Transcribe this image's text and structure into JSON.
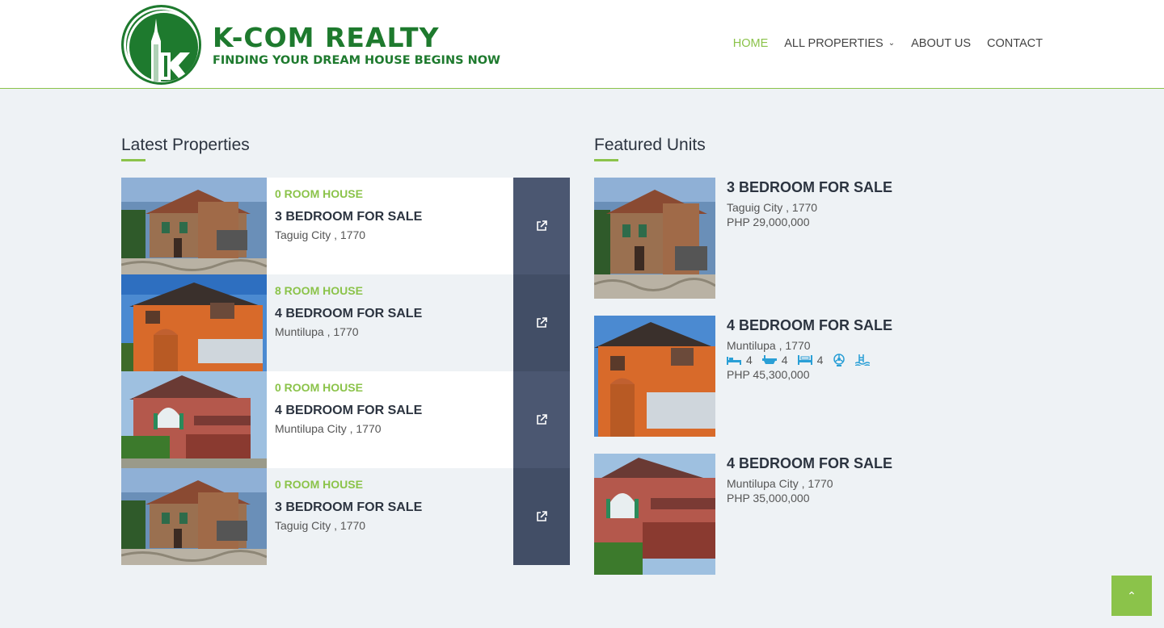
{
  "brand": {
    "logo_letter": "k",
    "title": "K-COM REALTY",
    "tagline": "FINDING YOUR DREAM HOUSE BEGINS NOW",
    "color": "#1e7a2e"
  },
  "nav": {
    "items": [
      {
        "label": "HOME",
        "active": true
      },
      {
        "label": "ALL PROPERTIES",
        "has_dropdown": true
      },
      {
        "label": "ABOUT US"
      },
      {
        "label": "CONTACT"
      }
    ]
  },
  "latest": {
    "heading": "Latest Properties",
    "items": [
      {
        "type": "0 ROOM HOUSE",
        "title": "3 BEDROOM FOR SALE",
        "location": "Taguig City , 1770",
        "link_icon": "external-link-icon"
      },
      {
        "type": "8 ROOM HOUSE",
        "title": "4 BEDROOM FOR SALE",
        "location": "Muntilupa , 1770",
        "link_icon": "external-link-icon"
      },
      {
        "type": "0 ROOM HOUSE",
        "title": "4 BEDROOM FOR SALE",
        "location": "Muntilupa City , 1770",
        "link_icon": "external-link-icon"
      },
      {
        "type": "0 ROOM HOUSE",
        "title": "3 BEDROOM FOR SALE",
        "location": "Taguig City , 1770",
        "link_icon": "external-link-icon"
      }
    ]
  },
  "featured": {
    "heading": "Featured Units",
    "items": [
      {
        "title": "3 BEDROOM FOR SALE",
        "location": "Taguig City , 1770",
        "price": "PHP 29,000,000"
      },
      {
        "title": "4 BEDROOM FOR SALE",
        "location": "Muntilupa , 1770",
        "price": "PHP 45,300,000",
        "amenities": {
          "bedrooms": "4",
          "bathrooms": "4",
          "beds": "4",
          "icons": [
            "bed-icon",
            "bathtub-icon",
            "bed-frame-icon",
            "fan-icon",
            "pool-icon"
          ]
        }
      },
      {
        "title": "4 BEDROOM FOR SALE",
        "location": "Muntilupa City , 1770",
        "price": "PHP 35,000,000"
      }
    ]
  },
  "back_to_top": {
    "icon": "chevron-up-icon",
    "glyph": "⌃"
  },
  "colors": {
    "accent": "#8bc34a",
    "link_panel": "#4b5771",
    "heading": "#2c3440",
    "page_bg": "#eef2f5"
  }
}
